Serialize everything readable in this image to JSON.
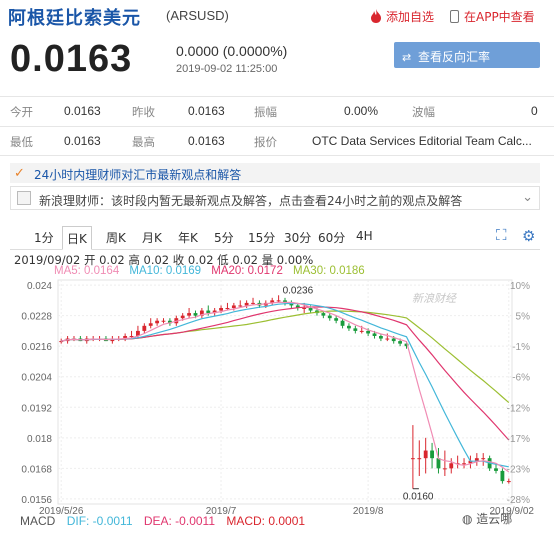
{
  "header": {
    "name": "阿根廷比索美元",
    "code": "(ARSUSD)",
    "fav_label": "添加自选",
    "app_label": "在APP中查看"
  },
  "quote": {
    "price": "0.0163",
    "change": "0.0000 (0.0000%)",
    "time": "2019-09-02 11:25:00",
    "reverse_btn": "查看反向汇率"
  },
  "stats": {
    "row1": [
      {
        "label": "今开",
        "value": "0.0163"
      },
      {
        "label": "昨收",
        "value": "0.0163"
      },
      {
        "label": "振幅",
        "value": "0.00%"
      },
      {
        "label": "波幅",
        "value": "0"
      }
    ],
    "row2": [
      {
        "label": "最低",
        "value": "0.0163"
      },
      {
        "label": "最高",
        "value": "0.0163"
      },
      {
        "label": "报价",
        "value": "OTC Data Services Editorial Team Calc..."
      }
    ]
  },
  "news": {
    "headline": "24小时内理财师对汇市最新观点和解答",
    "notice": "新浪理财师：该时段内暂无最新观点及解答，点击查看24小时之前的观点及解答"
  },
  "tabs": [
    "1分",
    "日K",
    "周K",
    "月K",
    "年K",
    "5分",
    "15分",
    "30分",
    "60分",
    "4H"
  ],
  "active_tab": "日K",
  "kline_info": "2019/09/02 开 0.02 高 0.02 收 0.02 低 0.02 量 0.00%",
  "ma": {
    "ma5": "MA5: 0.0164",
    "ma10": "MA10: 0.0169",
    "ma20": "MA20: 0.0172",
    "ma30": "MA30: 0.0186"
  },
  "watermark_logo": "新浪财经",
  "macd": {
    "title": "MACD",
    "dif": "DIF: -0.0011",
    "dea": "DEA: -0.0011",
    "macd": "MACD: 0.0001"
  },
  "watermark_bottom": "造云哪",
  "colors": {
    "up": "#d9262e",
    "down": "#1a9b3c",
    "ma5": "#f08cb4",
    "ma10": "#43b7d9",
    "ma20": "#e0366e",
    "ma30": "#9cbf32",
    "accent": "#1a56a8"
  },
  "chart_data": {
    "type": "candlestick",
    "x_labels": [
      "2019/5/26",
      "2019/7",
      "2019/8",
      "2019/9/02"
    ],
    "y_ticks": [
      "0.024",
      "0.0228",
      "0.0216",
      "0.0204",
      "0.0192",
      "0.018",
      "0.0168",
      "0.0156"
    ],
    "y_range": [
      0.0154,
      0.0242
    ],
    "pct_ticks": [
      "10%",
      "5%",
      "-1%",
      "-6%",
      "-12%",
      "-17%",
      "-23%",
      "-28%"
    ],
    "markers": {
      "high": "0.0236",
      "low": "0.0160"
    },
    "dates": [
      "2019/5/27",
      "2019/5/28",
      "2019/5/29",
      "2019/5/30",
      "2019/5/31",
      "2019/6/3",
      "2019/6/4",
      "2019/6/5",
      "2019/6/6",
      "2019/6/7",
      "2019/6/10",
      "2019/6/11",
      "2019/6/12",
      "2019/6/13",
      "2019/6/14",
      "2019/6/17",
      "2019/6/18",
      "2019/6/19",
      "2019/6/20",
      "2019/6/21",
      "2019/6/24",
      "2019/6/25",
      "2019/6/26",
      "2019/6/27",
      "2019/6/28",
      "2019/7/1",
      "2019/7/2",
      "2019/7/3",
      "2019/7/4",
      "2019/7/5",
      "2019/7/8",
      "2019/7/9",
      "2019/7/10",
      "2019/7/11",
      "2019/7/12",
      "2019/7/15",
      "2019/7/16",
      "2019/7/17",
      "2019/7/18",
      "2019/7/19",
      "2019/7/22",
      "2019/7/23",
      "2019/7/24",
      "2019/7/25",
      "2019/7/26",
      "2019/7/29",
      "2019/7/30",
      "2019/7/31",
      "2019/8/1",
      "2019/8/2",
      "2019/8/5",
      "2019/8/6",
      "2019/8/7",
      "2019/8/8",
      "2019/8/9",
      "2019/8/12",
      "2019/8/13",
      "2019/8/14",
      "2019/8/15",
      "2019/8/16",
      "2019/8/19",
      "2019/8/20",
      "2019/8/21",
      "2019/8/22",
      "2019/8/23",
      "2019/8/26",
      "2019/8/27",
      "2019/8/28",
      "2019/8/29",
      "2019/8/30",
      "2019/9/2"
    ],
    "open": [
      0.0218,
      0.0218,
      0.0219,
      0.0219,
      0.0218,
      0.0219,
      0.0219,
      0.0219,
      0.0218,
      0.0219,
      0.0219,
      0.022,
      0.022,
      0.0222,
      0.0224,
      0.0225,
      0.0226,
      0.0226,
      0.0225,
      0.0227,
      0.0228,
      0.0229,
      0.0228,
      0.023,
      0.0229,
      0.023,
      0.0231,
      0.0231,
      0.0232,
      0.0232,
      0.0233,
      0.0233,
      0.0232,
      0.0233,
      0.0234,
      0.0234,
      0.0233,
      0.0232,
      0.0231,
      0.0231,
      0.023,
      0.0229,
      0.0228,
      0.0227,
      0.0226,
      0.0224,
      0.0223,
      0.0222,
      0.0222,
      0.0221,
      0.022,
      0.0219,
      0.0219,
      0.0218,
      0.0217,
      0.0172,
      0.0172,
      0.0172,
      0.0175,
      0.0172,
      0.0168,
      0.0168,
      0.017,
      0.017,
      0.017,
      0.0171,
      0.0172,
      0.0172,
      0.0168,
      0.0167,
      0.0163
    ],
    "high": [
      0.0219,
      0.022,
      0.022,
      0.022,
      0.022,
      0.022,
      0.022,
      0.022,
      0.022,
      0.022,
      0.0221,
      0.0222,
      0.0224,
      0.0225,
      0.0227,
      0.0227,
      0.0227,
      0.0227,
      0.0228,
      0.0229,
      0.0231,
      0.023,
      0.0231,
      0.0232,
      0.0231,
      0.0232,
      0.0233,
      0.0233,
      0.0234,
      0.0234,
      0.0235,
      0.0234,
      0.0234,
      0.0235,
      0.0236,
      0.0235,
      0.0234,
      0.0233,
      0.0233,
      0.0232,
      0.0231,
      0.023,
      0.0229,
      0.0228,
      0.0227,
      0.0225,
      0.0224,
      0.0224,
      0.0223,
      0.0222,
      0.0221,
      0.0221,
      0.022,
      0.0219,
      0.0218,
      0.0185,
      0.0179,
      0.018,
      0.0178,
      0.0176,
      0.0175,
      0.0172,
      0.0173,
      0.0172,
      0.0173,
      0.0174,
      0.0174,
      0.0173,
      0.017,
      0.0168,
      0.0164
    ],
    "low": [
      0.0217,
      0.0217,
      0.0218,
      0.0218,
      0.0217,
      0.0218,
      0.0218,
      0.0218,
      0.0217,
      0.0218,
      0.0218,
      0.0219,
      0.0219,
      0.0221,
      0.0223,
      0.0224,
      0.0225,
      0.0224,
      0.0224,
      0.0226,
      0.0227,
      0.0227,
      0.0227,
      0.0228,
      0.0228,
      0.0229,
      0.023,
      0.023,
      0.0231,
      0.0231,
      0.0232,
      0.0231,
      0.0231,
      0.0232,
      0.0233,
      0.0232,
      0.0231,
      0.023,
      0.0229,
      0.0229,
      0.0228,
      0.0227,
      0.0226,
      0.0225,
      0.0223,
      0.0222,
      0.0221,
      0.0221,
      0.022,
      0.0219,
      0.0218,
      0.0218,
      0.0217,
      0.0216,
      0.0215,
      0.016,
      0.0165,
      0.0166,
      0.0168,
      0.0166,
      0.0165,
      0.0166,
      0.0168,
      0.0168,
      0.0168,
      0.0169,
      0.0169,
      0.0167,
      0.0166,
      0.0162,
      0.0162
    ],
    "close": [
      0.0218,
      0.0219,
      0.0219,
      0.0218,
      0.0219,
      0.0219,
      0.0219,
      0.0218,
      0.0219,
      0.0219,
      0.022,
      0.022,
      0.0222,
      0.0224,
      0.0225,
      0.0226,
      0.0226,
      0.0225,
      0.0227,
      0.0228,
      0.0229,
      0.0228,
      0.023,
      0.0229,
      0.023,
      0.0231,
      0.0231,
      0.0232,
      0.0232,
      0.0233,
      0.0233,
      0.0232,
      0.0233,
      0.0234,
      0.0234,
      0.0233,
      0.0232,
      0.0231,
      0.0231,
      0.023,
      0.0229,
      0.0228,
      0.0227,
      0.0226,
      0.0224,
      0.0223,
      0.0222,
      0.0222,
      0.0221,
      0.022,
      0.0219,
      0.0219,
      0.0218,
      0.0217,
      0.0216,
      0.0172,
      0.0172,
      0.0175,
      0.0172,
      0.0168,
      0.0168,
      0.017,
      0.017,
      0.017,
      0.0171,
      0.0172,
      0.0172,
      0.0168,
      0.0167,
      0.0163,
      0.0163
    ]
  }
}
